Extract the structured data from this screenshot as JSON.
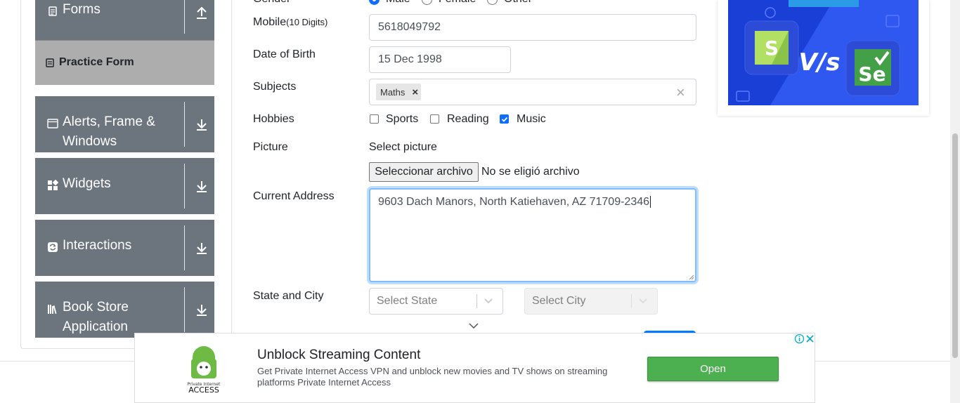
{
  "sidebar": {
    "groups": [
      {
        "label": "Forms",
        "icon": "document-icon"
      },
      {
        "label": "Alerts, Frame &",
        "label2": "Windows",
        "icon": "window-icon"
      },
      {
        "label": "Widgets",
        "icon": "widgets-icon"
      },
      {
        "label": "Interactions",
        "icon": "interactions-icon"
      },
      {
        "label": "Book Store",
        "label2": "Application",
        "icon": "books-icon"
      }
    ],
    "active_item": "Practice Form"
  },
  "form": {
    "gender": {
      "label": "Gender",
      "options": [
        "Male",
        "Female",
        "Other"
      ],
      "selected": "Male"
    },
    "mobile": {
      "label": "Mobile",
      "hint": "(10 Digits)",
      "value": "5618049792"
    },
    "dob": {
      "label": "Date of Birth",
      "value": "15 Dec 1998"
    },
    "subjects": {
      "label": "Subjects",
      "tags": [
        "Maths"
      ],
      "clear": "×"
    },
    "hobbies": {
      "label": "Hobbies",
      "options": [
        {
          "label": "Sports",
          "checked": false
        },
        {
          "label": "Reading",
          "checked": false
        },
        {
          "label": "Music",
          "checked": true
        }
      ]
    },
    "picture": {
      "label": "Picture",
      "select_label": "Select picture",
      "button": "Seleccionar archivo",
      "status": "No se eligió archivo"
    },
    "address": {
      "label": "Current Address",
      "value": "9603 Dach Manors, North Katiehaven, AZ 71709-2346"
    },
    "state_city": {
      "label": "State and City",
      "state_placeholder": "Select State",
      "city_placeholder": "Select City"
    }
  },
  "ad": {
    "headline": "Unblock Streaming Content",
    "body_line1": "Get Private Internet Access VPN and unblock new movies and TV shows on streaming",
    "body_line2": "platforms Private Internet Access",
    "button": "Open",
    "brand_small": "Private Internet",
    "brand": "ACCESS"
  },
  "banner": {
    "left_letter": "S",
    "vs": "V/s",
    "right_letter": "Se"
  },
  "colors": {
    "sidebar": "#6c757d",
    "active": "#adadad",
    "checkbox": "#0d6efd",
    "ad_button": "#4caf50",
    "banner": "#1a3fd6"
  }
}
